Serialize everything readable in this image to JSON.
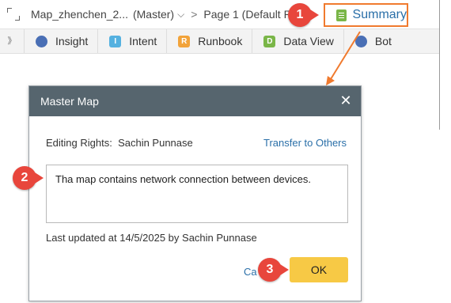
{
  "app": {
    "tab_map_name": "Map_zhenchen_2...",
    "tab_map_mode": "(Master)",
    "tab_page": "Page 1 (Default P",
    "summary_label": "Summary",
    "toolbar": [
      {
        "label": "Insight",
        "icon": "insight-icon"
      },
      {
        "label": "Intent",
        "icon": "intent-icon",
        "glyph": "I"
      },
      {
        "label": "Runbook",
        "icon": "runbook-icon",
        "glyph": "R"
      },
      {
        "label": "Data View",
        "icon": "data-view-icon",
        "glyph": "D"
      },
      {
        "label": "Bot",
        "icon": "bot-icon"
      }
    ]
  },
  "dialog": {
    "title": "Master Map",
    "editing_rights_label": "Editing Rights:",
    "editing_rights_user": "Sachin Punnase",
    "transfer_link": "Transfer to Others",
    "description": "Tha map contains network connection between devices.",
    "last_updated": "Last updated at 14/5/2025 by Sachin Punnase",
    "cancel_label": "Ca",
    "ok_label": "OK"
  },
  "callouts": [
    "1",
    "2",
    "3"
  ],
  "colors": {
    "accent_orange": "#f07a2e",
    "callout_red": "#e8463c",
    "ok_yellow": "#f7c945",
    "dialog_header": "#56656e",
    "link_blue": "#2a6fa8"
  }
}
